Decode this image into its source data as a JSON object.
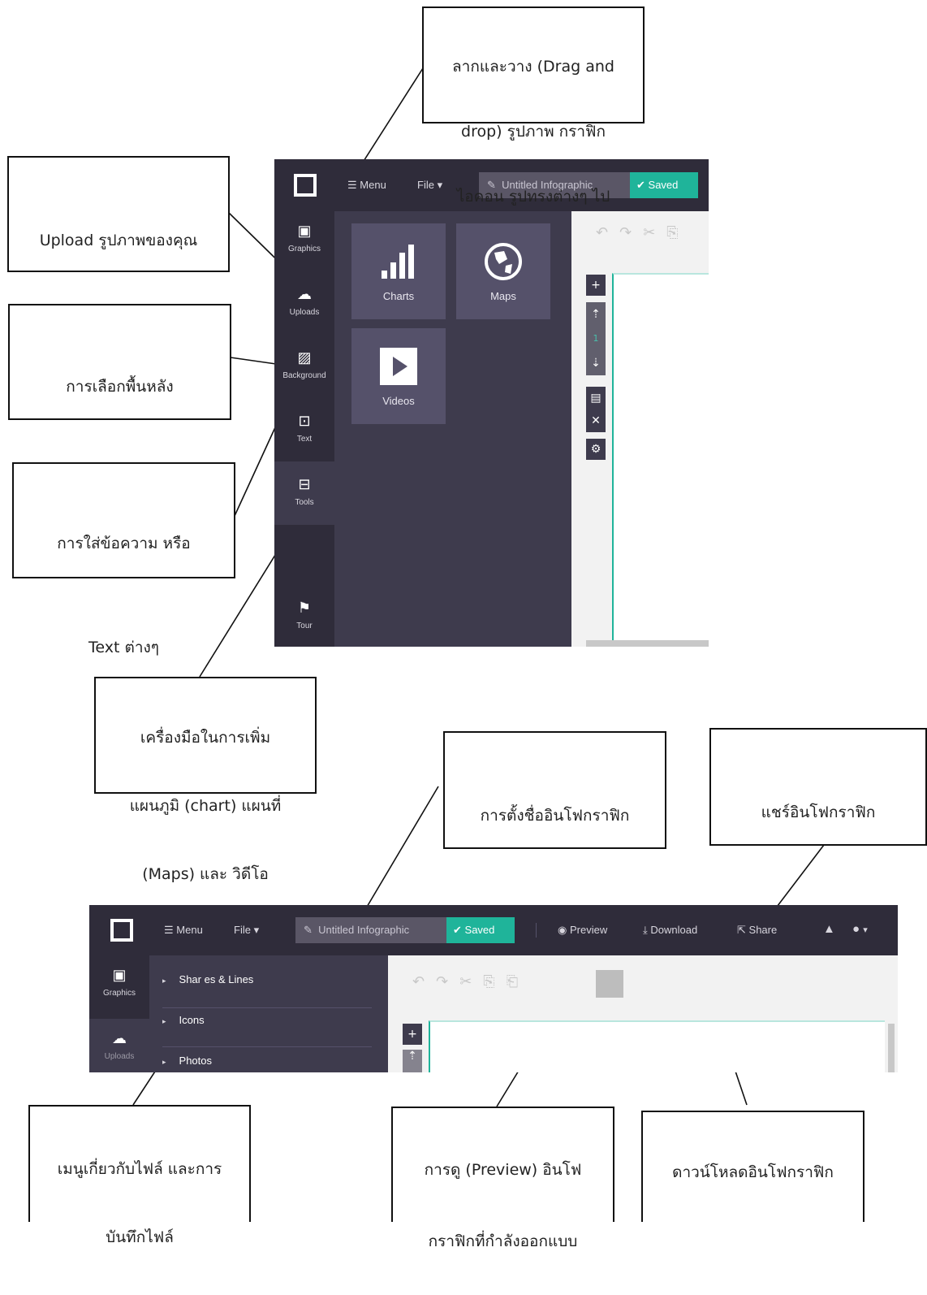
{
  "app": {
    "menu_label": "Menu",
    "file_label": "File",
    "title_placeholder": "Untitled Infographic",
    "saved_label": "Saved",
    "preview_label": "Preview",
    "download_label": "Download",
    "share_label": "Share"
  },
  "sidebar": {
    "items": [
      {
        "label": "Graphics",
        "icon": "image-icon"
      },
      {
        "label": "Uploads",
        "icon": "cloud-upload-icon"
      },
      {
        "label": "Background",
        "icon": "hatch-icon"
      },
      {
        "label": "Text",
        "icon": "text-box-icon"
      },
      {
        "label": "Tools",
        "icon": "toolbox-icon"
      },
      {
        "label": "Tour",
        "icon": "signpost-icon"
      }
    ]
  },
  "tools_panel": {
    "tiles": [
      {
        "label": "Charts",
        "icon": "bar-chart-icon"
      },
      {
        "label": "Maps",
        "icon": "globe-icon"
      },
      {
        "label": "Videos",
        "icon": "play-icon"
      }
    ]
  },
  "graphics_panel": {
    "rows": [
      "Shar es & Lines",
      "Icons",
      "Photos"
    ]
  },
  "callouts": {
    "drag_drop": [
      "ลากและวาง (Drag and",
      "drop) รูปภาพ กราฟิก",
      "ไอคอน รูปทรงต่างๆ ไป"
    ],
    "upload": [
      "Upload รูปภาพของคุณ"
    ],
    "background": [
      "การเลือกพื้นหลัง"
    ],
    "text": [
      "การใส่ข้อความ หรือ",
      "Text ต่างๆ"
    ],
    "tools": [
      "เครื่องมือในการเพิ่ม",
      "แผนภูมิ (chart) แผนที่",
      "(Maps) และ วิดีโอ"
    ],
    "naming": [
      "การตั้งชื่ออินโฟกราฟิก"
    ],
    "share": [
      "แชร์อินโฟกราฟิก"
    ],
    "file_menu": [
      "เมนูเกี่ยวกับไฟล์ และการ",
      "บันทึกไฟล์"
    ],
    "preview": [
      "การดู (Preview)  อินโฟ",
      "กราฟิกที่กำลังออกแบบ"
    ],
    "download": [
      "ดาวน์โหลดอินโฟกราฟิก"
    ]
  }
}
